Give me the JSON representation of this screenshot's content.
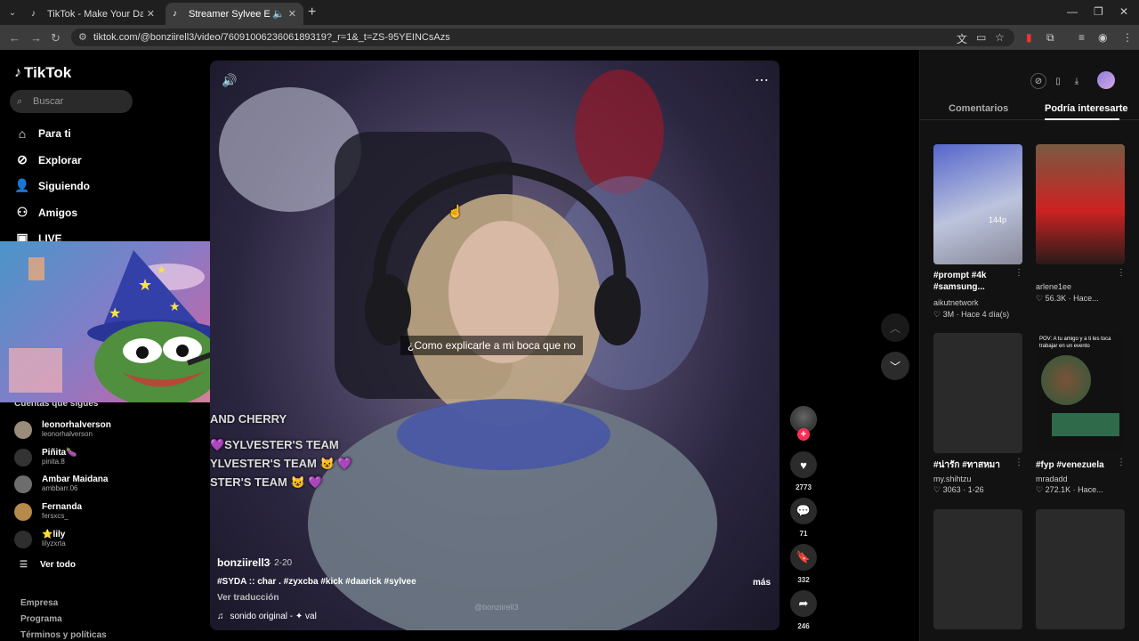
{
  "browser": {
    "tabs": [
      {
        "title": "TikTok - Make Your Day",
        "close": "✕"
      },
      {
        "title": "Streamer Sylvee Eats Sandw",
        "close": "✕"
      }
    ],
    "new_tab": "+",
    "url": "tiktok.com/@bonziirell3/video/7609100623606189319?_r=1&_t=ZS-95YEINCsAzs"
  },
  "sidebar": {
    "logo": "TikTok",
    "search_placeholder": "Buscar",
    "nav": [
      "Para ti",
      "Explorar",
      "Siguiendo",
      "Amigos",
      "LIVE"
    ],
    "following_title": "Cuentas que sigues",
    "accounts": [
      {
        "name": "leonorhalverson",
        "handle": "leonorhalverson"
      },
      {
        "name": "Piñita🍆",
        "handle": "pinita.8"
      },
      {
        "name": "Ambar Maidana",
        "handle": "ambbarr.06"
      },
      {
        "name": "Fernanda",
        "handle": "fersxcs_"
      },
      {
        "name": "⭐lily",
        "handle": "lilyzxrta"
      }
    ],
    "see_all": "Ver todo",
    "footer": [
      "Empresa",
      "Programa",
      "Términos y políticas"
    ]
  },
  "video": {
    "caption": "¿Como explicarle a mi boca que no",
    "overlay_lines": [
      "AND CHERRY",
      "💜SYLVESTER'S TEAM",
      "YLVESTER'S TEAM 😺 💜",
      "STER'S TEAM 😺 💜"
    ],
    "author": "bonziirell3",
    "date": "· 2-20",
    "description": "#SYDA :: char . #zyxcba #kick #daarick #sylvee",
    "more": "más",
    "translate": "Ver traducción",
    "music": "sonido original - ✦ val",
    "watermark": "@bonziirell3",
    "likes": "2773",
    "comments": "71",
    "saves": "332",
    "shares": "246"
  },
  "right_panel": {
    "tabs": [
      "Comentarios",
      "Podría interesarte"
    ],
    "cards": [
      {
        "title": "#prompt #4k #samsung...",
        "author": "aikutnetwork",
        "meta": "♡ 3M · Hace 4 día(s)",
        "badge": "144p"
      },
      {
        "title": "",
        "author": "arlene1ee",
        "meta": "♡ 56.3K · Hace..."
      },
      {
        "title": "#น่ารัก #ทาสหมา",
        "author": "my.shihtzu",
        "meta": "♡ 3063 · 1-26"
      },
      {
        "title": "#fyp #venezuela",
        "author": "mradadd",
        "meta": "♡ 272.1K · Hace..."
      }
    ],
    "thumb_banner": "POV: A tu amigo y a ti les toca trabajar en un evento"
  },
  "colors": {
    "accent": "#fe2c55",
    "panel": "#121212",
    "chrome": "#1f1f1f"
  }
}
